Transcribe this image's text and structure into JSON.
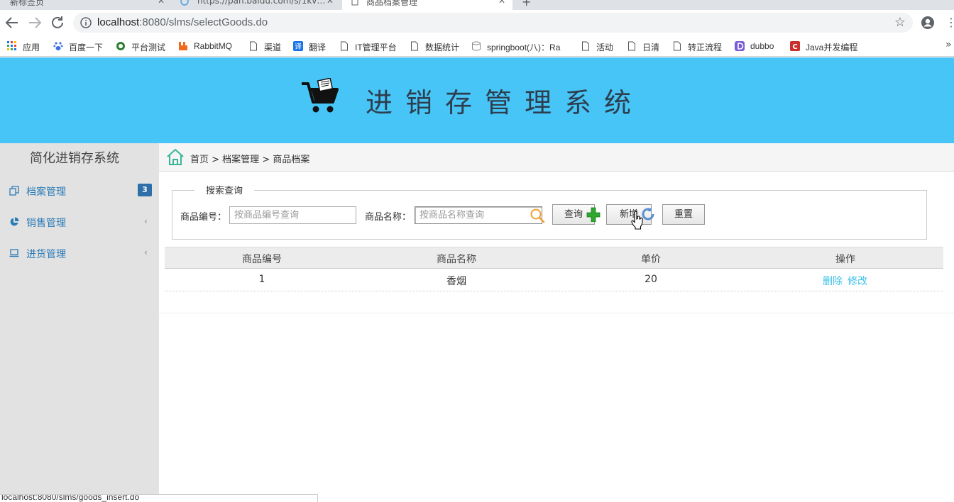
{
  "browser": {
    "tabs": [
      {
        "label": "新标签页",
        "active": false
      },
      {
        "label": "https://pan.baidu.com/s/1kv…",
        "active": false
      },
      {
        "label": "商品档案管理",
        "active": true
      }
    ],
    "address": {
      "host": "localhost",
      "rest": ":8080/slms/selectGoods.do"
    },
    "bookmarks": [
      {
        "label": "应用",
        "icon": "apps-grid-icon"
      },
      {
        "label": "百度一下",
        "icon": "baidu-paw-icon"
      },
      {
        "label": "平台测试",
        "icon": "globe-icon"
      },
      {
        "label": "RabbitMQ",
        "icon": "rabbitmq-icon"
      },
      {
        "label": "渠道",
        "icon": "page-icon"
      },
      {
        "label": "翻译",
        "icon": "translate-icon"
      },
      {
        "label": "IT管理平台",
        "icon": "page-icon"
      },
      {
        "label": "数据统计",
        "icon": "page-icon"
      },
      {
        "label": "springboot(八)：Ra",
        "icon": "db-icon"
      },
      {
        "label": "活动",
        "icon": "page-icon"
      },
      {
        "label": "日清",
        "icon": "page-icon"
      },
      {
        "label": "转正流程",
        "icon": "page-icon"
      },
      {
        "label": "dubbo",
        "icon": "dubbo-icon"
      },
      {
        "label": "Java并发编程",
        "icon": "csdn-icon"
      }
    ],
    "more": "»",
    "status_url": "localhost:8080/slms/goods_insert.do"
  },
  "header": {
    "title": "进销存管理系统"
  },
  "sidebar": {
    "title": "简化进销存系统",
    "items": [
      {
        "label": "档案管理",
        "icon": "copy-icon",
        "badge": "3"
      },
      {
        "label": "销售管理",
        "icon": "pie-chart-icon",
        "chevron": "‹"
      },
      {
        "label": "进货管理",
        "icon": "laptop-icon",
        "chevron": "‹"
      }
    ]
  },
  "breadcrumb": {
    "text": "首页 > 档案管理 > 商品档案"
  },
  "search": {
    "legend": "搜索查询",
    "code_label": "商品编号：",
    "code_placeholder": "按商品编号查询",
    "name_label": "商品名称：",
    "name_placeholder": "按商品名称查询",
    "query_label": "查询",
    "add_label": "新增",
    "reset_label": "重置"
  },
  "table": {
    "headers": [
      "商品编号",
      "商品名称",
      "单价",
      "操作"
    ],
    "rows": [
      {
        "code": "1",
        "name": "香烟",
        "price": "20",
        "delete": "删除",
        "edit": "修改"
      }
    ]
  },
  "colors": {
    "header_bg": "#47c5f7",
    "sidebar_bg": "#e2e2e2",
    "link": "#3cc2e8",
    "badge": "#2f6fa8"
  }
}
